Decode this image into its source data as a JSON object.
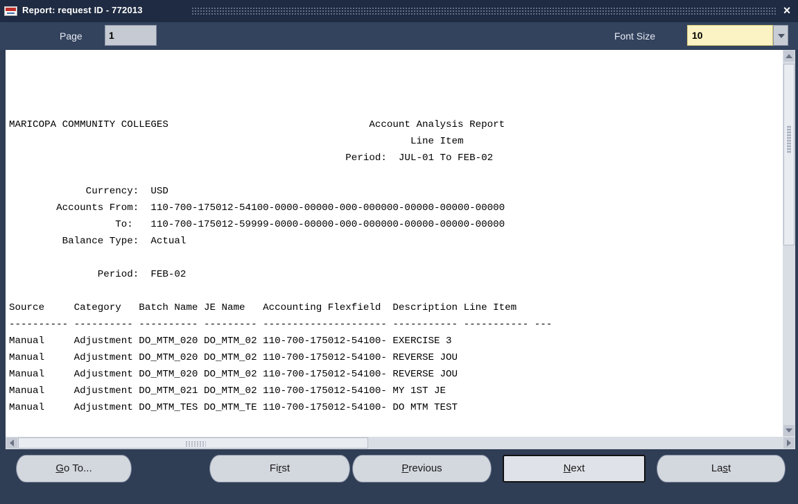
{
  "window": {
    "title": "Report: request ID - 772013",
    "close_glyph": "×"
  },
  "toolbar": {
    "page_label": "Page",
    "page_value": "1",
    "font_size_label": "Font Size",
    "font_size_value": "10"
  },
  "report": {
    "lines": [
      "",
      "",
      "",
      "",
      "MARICOPA COMMUNITY COLLEGES                                  Account Analysis Report",
      "                                                                    Line Item",
      "                                                         Period:  JUL-01 To FEB-02",
      "",
      "             Currency:  USD",
      "        Accounts From:  110-700-175012-54100-0000-00000-000-000000-00000-00000-00000",
      "                  To:   110-700-175012-59999-0000-00000-000-000000-00000-00000-00000",
      "         Balance Type:  Actual",
      "",
      "               Period:  FEB-02",
      "",
      "Source     Category   Batch Name JE Name   Accounting Flexfield  Description Line Item",
      "---------- ---------- ---------- --------- --------------------- ----------- ----------- ---",
      "Manual     Adjustment DO_MTM_020 DO_MTM_02 110-700-175012-54100- EXERCISE 3",
      "Manual     Adjustment DO_MTM_020 DO_MTM_02 110-700-175012-54100- REVERSE JOU",
      "Manual     Adjustment DO_MTM_020 DO_MTM_02 110-700-175012-54100- REVERSE JOU",
      "Manual     Adjustment DO_MTM_021 DO_MTM_02 110-700-175012-54100- MY 1ST JE",
      "Manual     Adjustment DO_MTM_TES DO_MTM_TE 110-700-175012-54100- DO MTM TEST"
    ]
  },
  "buttons": {
    "goto": {
      "mnemonic": "G",
      "rest": "o To..."
    },
    "first": {
      "pre": "Fi",
      "mnemonic": "r",
      "rest": "st"
    },
    "previous": {
      "mnemonic": "P",
      "rest": "revious"
    },
    "next": {
      "mnemonic": "N",
      "rest": "ext"
    },
    "last": {
      "pre": "La",
      "mnemonic": "s",
      "rest": "t"
    }
  }
}
